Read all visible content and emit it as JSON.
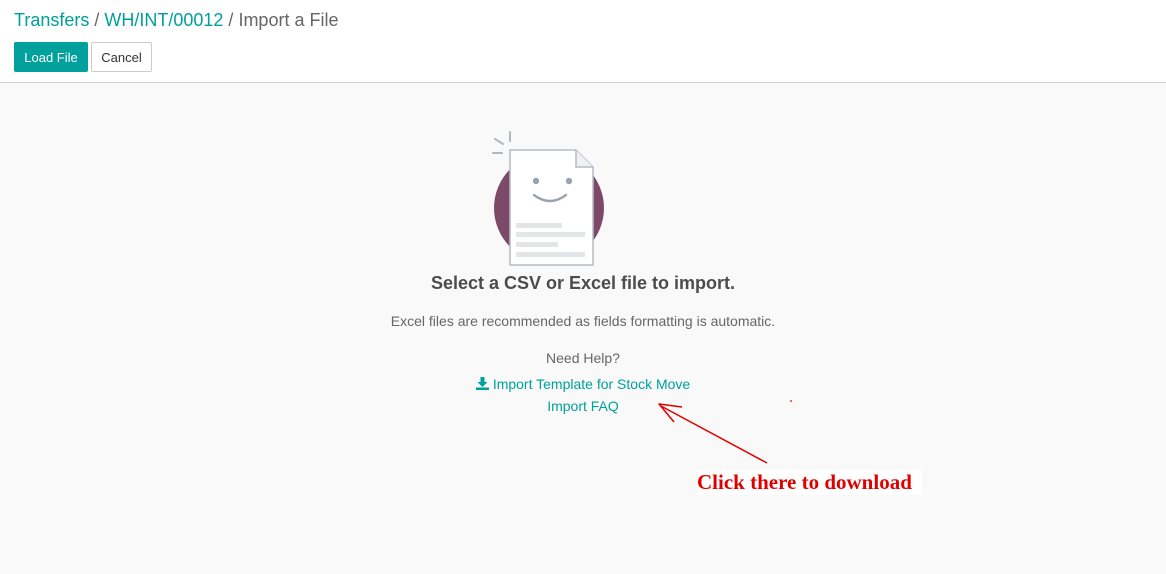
{
  "breadcrumb": {
    "items": [
      "Transfers",
      "WH/INT/00012"
    ],
    "separator": "/",
    "current": "Import a File"
  },
  "toolbar": {
    "load_label": "Load File",
    "cancel_label": "Cancel"
  },
  "help": {
    "title": "Select a CSV or Excel file to import.",
    "description": "Excel files are recommended as fields formatting is automatic.",
    "need_help": "Need Help?",
    "template_link": "Import Template for Stock Move",
    "faq_link": "Import FAQ"
  },
  "annotation": {
    "text": "Click there to download"
  },
  "colors": {
    "accent": "#00a09d",
    "illustration_circle": "#7c4a68",
    "annotation": "#e00000"
  },
  "icons": {
    "download": "download-icon",
    "illustration": "smiling-document-illustration"
  }
}
